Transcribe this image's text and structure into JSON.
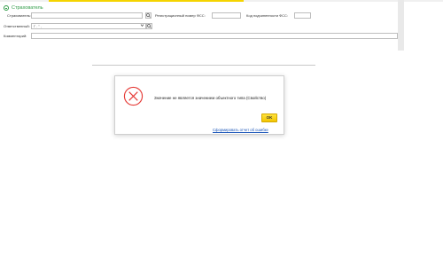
{
  "group": {
    "title": "Страхователь"
  },
  "form": {
    "insurer_label": "Страхователь:",
    "insurer_value": "",
    "reg_label": "Регистрационный номер ФСС:",
    "reg_value": "",
    "subord_label": "Код подчиненности ФСС:",
    "subord_value": "",
    "responsible_label": "Ответственный:",
    "responsible_value": "Г      .          \"                          ,",
    "comment_label": "Комментарий:",
    "comment_value": ""
  },
  "icons": {
    "search": "magnifier-icon",
    "select": "ellipsis-icon",
    "dropdown": "chevron-down-icon",
    "group_toggle": "collapse-icon",
    "error": "error-icon"
  },
  "dialog": {
    "message": "Значение не является значением объектного типа (Свойство)",
    "ok_label": "OK",
    "report_link": "Сформировать отчет об ошибке"
  },
  "colors": {
    "accent_green": "#2e9b45",
    "error_red": "#e53935",
    "ok_yellow": "#f5d400",
    "link_blue": "#1a55b8"
  }
}
